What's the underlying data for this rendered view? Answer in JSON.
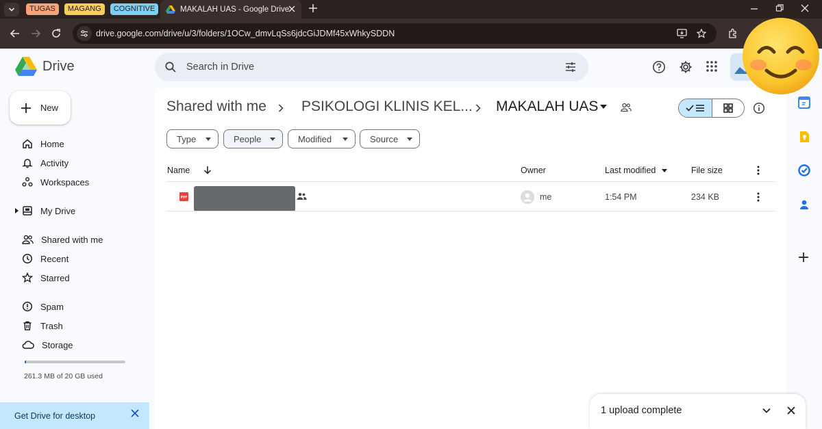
{
  "browser": {
    "tab_groups": [
      "TUGAS",
      "MAGANG",
      "COGNITIVE"
    ],
    "active_tab_title": "MAKALAH UAS - Google Drive",
    "url": "drive.google.com/drive/u/3/folders/1OCw_dmvLqSs6jdcGiJDMf45xWhkySDDN"
  },
  "app": {
    "name": "Drive",
    "search_placeholder": "Search in Drive",
    "new_label": "New"
  },
  "sidebar": {
    "items": [
      {
        "label": "Home",
        "icon": "home-icon"
      },
      {
        "label": "Activity",
        "icon": "bell-icon"
      },
      {
        "label": "Workspaces",
        "icon": "workspaces-icon"
      },
      {
        "label": "My Drive",
        "icon": "my-drive-icon"
      },
      {
        "label": "Shared with me",
        "icon": "people-icon"
      },
      {
        "label": "Recent",
        "icon": "clock-icon"
      },
      {
        "label": "Starred",
        "icon": "star-icon"
      },
      {
        "label": "Spam",
        "icon": "spam-icon"
      },
      {
        "label": "Trash",
        "icon": "trash-icon"
      },
      {
        "label": "Storage",
        "icon": "cloud-icon"
      }
    ],
    "storage_text": "261.3 MB of 20 GB used",
    "storage_fraction": 0.013,
    "desktop_banner": "Get Drive for desktop"
  },
  "breadcrumb": [
    "Shared with me",
    "PSIKOLOGI KLINIS KEL...",
    "MAKALAH UAS"
  ],
  "filters": [
    "Type",
    "People",
    "Modified",
    "Source"
  ],
  "table": {
    "columns": {
      "name": "Name",
      "owner": "Owner",
      "modified": "Last modified",
      "size": "File size"
    },
    "rows": [
      {
        "file_type": "PDF",
        "owner": "me",
        "modified": "1:54 PM",
        "size": "234 KB"
      }
    ]
  },
  "toast": {
    "message": "1 upload complete"
  },
  "colors": {
    "accent": "#0b57d0",
    "selected": "#c2e7ff",
    "pdf": "#ea4335"
  }
}
